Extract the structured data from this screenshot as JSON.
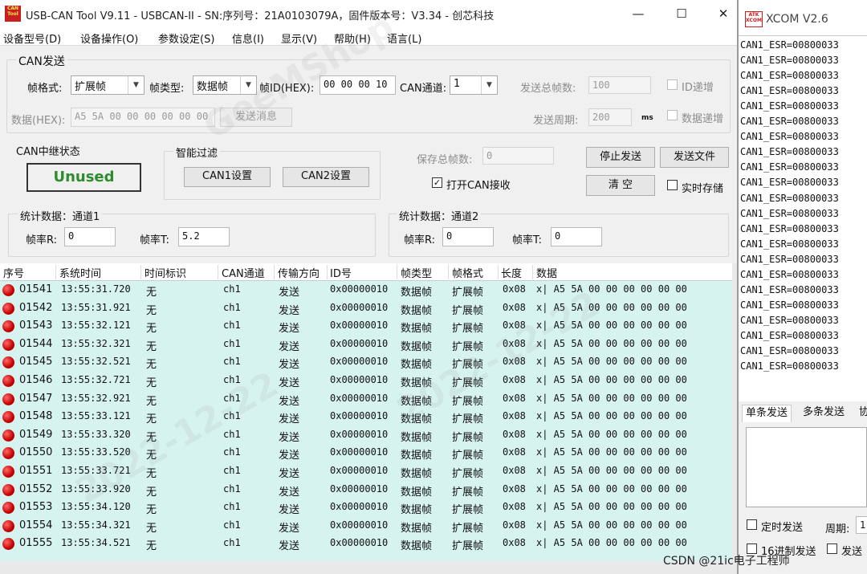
{
  "window": {
    "title": "USB-CAN Tool V9.11 - USBCAN-II - SN:序列号：21A0103079A，固件版本号：V3.34 - 创芯科技",
    "minimize": "—",
    "maximize": "☐",
    "logo_text": "CAN Tool"
  },
  "menu": [
    "设备型号(D)",
    "设备操作(O)",
    "参数设定(S)",
    "信息(I)",
    "显示(V)",
    "帮助(H)",
    "语言(L)"
  ],
  "can_send": {
    "group_title": "CAN发送",
    "frame_format_label": "帧格式:",
    "frame_format_value": "扩展帧",
    "frame_type_label": "帧类型:",
    "frame_type_value": "数据帧",
    "frame_id_label": "帧ID(HEX):",
    "frame_id_value": "00 00 00 10",
    "channel_label": "CAN通道:",
    "channel_value": "1",
    "data_label": "数据(HEX):",
    "data_value": "A5 5A 00 00 00 00 00 00",
    "send_button": "发送消息",
    "total_frames_label": "发送总帧数:",
    "total_frames_value": "100",
    "id_inc_label": "ID递增",
    "period_label": "发送周期:",
    "period_value": "200",
    "period_unit": "ms",
    "data_inc_label": "数据递增"
  },
  "relay": {
    "title": "CAN中继状态",
    "status": "Unused",
    "status_color": "#2e8b2e"
  },
  "filter": {
    "title": "智能过滤",
    "can1_button": "CAN1设置",
    "can2_button": "CAN2设置"
  },
  "controls": {
    "save_total_label": "保存总帧数:",
    "save_total_value": "0",
    "open_can_rx_label": "打开CAN接收",
    "stop_send_button": "停止发送",
    "send_file_button": "发送文件",
    "clear_button": "清 空",
    "realtime_save_label": "实时存储"
  },
  "stats1": {
    "title": "统计数据：通道1",
    "rate_r_label": "帧率R:",
    "rate_r_value": "0",
    "rate_t_label": "帧率T:",
    "rate_t_value": "5.2"
  },
  "stats2": {
    "title": "统计数据：通道2",
    "rate_r_label": "帧率R:",
    "rate_r_value": "0",
    "rate_t_label": "帧率T:",
    "rate_t_value": "0"
  },
  "table": {
    "headers": [
      "序号",
      "系统时间",
      "时间标识",
      "CAN通道",
      "传输方向",
      "ID号",
      "帧类型",
      "帧格式",
      "长度",
      "数据"
    ],
    "row_color": "#d7f3f0",
    "rows": [
      [
        "01541",
        "13:55:31.720",
        "无",
        "ch1",
        "发送",
        "0x00000010",
        "数据帧",
        "扩展帧",
        "0x08",
        "x| A5 5A 00 00 00 00 00 00"
      ],
      [
        "01542",
        "13:55:31.921",
        "无",
        "ch1",
        "发送",
        "0x00000010",
        "数据帧",
        "扩展帧",
        "0x08",
        "x| A5 5A 00 00 00 00 00 00"
      ],
      [
        "01543",
        "13:55:32.121",
        "无",
        "ch1",
        "发送",
        "0x00000010",
        "数据帧",
        "扩展帧",
        "0x08",
        "x| A5 5A 00 00 00 00 00 00"
      ],
      [
        "01544",
        "13:55:32.321",
        "无",
        "ch1",
        "发送",
        "0x00000010",
        "数据帧",
        "扩展帧",
        "0x08",
        "x| A5 5A 00 00 00 00 00 00"
      ],
      [
        "01545",
        "13:55:32.521",
        "无",
        "ch1",
        "发送",
        "0x00000010",
        "数据帧",
        "扩展帧",
        "0x08",
        "x| A5 5A 00 00 00 00 00 00"
      ],
      [
        "01546",
        "13:55:32.721",
        "无",
        "ch1",
        "发送",
        "0x00000010",
        "数据帧",
        "扩展帧",
        "0x08",
        "x| A5 5A 00 00 00 00 00 00"
      ],
      [
        "01547",
        "13:55:32.921",
        "无",
        "ch1",
        "发送",
        "0x00000010",
        "数据帧",
        "扩展帧",
        "0x08",
        "x| A5 5A 00 00 00 00 00 00"
      ],
      [
        "01548",
        "13:55:33.121",
        "无",
        "ch1",
        "发送",
        "0x00000010",
        "数据帧",
        "扩展帧",
        "0x08",
        "x| A5 5A 00 00 00 00 00 00"
      ],
      [
        "01549",
        "13:55:33.320",
        "无",
        "ch1",
        "发送",
        "0x00000010",
        "数据帧",
        "扩展帧",
        "0x08",
        "x| A5 5A 00 00 00 00 00 00"
      ],
      [
        "01550",
        "13:55:33.520",
        "无",
        "ch1",
        "发送",
        "0x00000010",
        "数据帧",
        "扩展帧",
        "0x08",
        "x| A5 5A 00 00 00 00 00 00"
      ],
      [
        "01551",
        "13:55:33.721",
        "无",
        "ch1",
        "发送",
        "0x00000010",
        "数据帧",
        "扩展帧",
        "0x08",
        "x| A5 5A 00 00 00 00 00 00"
      ],
      [
        "01552",
        "13:55:33.920",
        "无",
        "ch1",
        "发送",
        "0x00000010",
        "数据帧",
        "扩展帧",
        "0x08",
        "x| A5 5A 00 00 00 00 00 00"
      ],
      [
        "01553",
        "13:55:34.120",
        "无",
        "ch1",
        "发送",
        "0x00000010",
        "数据帧",
        "扩展帧",
        "0x08",
        "x| A5 5A 00 00 00 00 00 00"
      ],
      [
        "01554",
        "13:55:34.321",
        "无",
        "ch1",
        "发送",
        "0x00000010",
        "数据帧",
        "扩展帧",
        "0x08",
        "x| A5 5A 00 00 00 00 00 00"
      ],
      [
        "01555",
        "13:55:34.521",
        "无",
        "ch1",
        "发送",
        "0x00000010",
        "数据帧",
        "扩展帧",
        "0x08",
        "x| A5 5A 00 00 00 00 00 00"
      ]
    ]
  },
  "xcom": {
    "title": "XCOM V2.6",
    "logo_text": "ATK XCOM",
    "log_lines": [
      "CAN1_ESR=00800033",
      "CAN1_ESR=00800033",
      "CAN1_ESR=00800033",
      "CAN1_ESR=00800033",
      "CAN1_ESR=00800033",
      "CAN1_ESR=00800033",
      "CAN1_ESR=00800033",
      "CAN1_ESR=00800033",
      "CAN1_ESR=00800033",
      "CAN1_ESR=00800033",
      "CAN1_ESR=00800033",
      "CAN1_ESR=00800033",
      "CAN1_ESR=00800033",
      "CAN1_ESR=00800033",
      "CAN1_ESR=00800033",
      "CAN1_ESR=00800033",
      "CAN1_ESR=00800033",
      "CAN1_ESR=00800033",
      "CAN1_ESR=00800033",
      "CAN1_ESR=00800033",
      "CAN1_ESR=00800033",
      "CAN1_ESR=00800033"
    ],
    "tab_single": "单条发送",
    "tab_multi": "多条发送",
    "tab_partial": "协",
    "timed_send_label": "定时发送",
    "period_label": "周期:",
    "period_partial": "1(",
    "hex_send_label": "16进制发送",
    "send_partial": "发送",
    "watermark": "CSDN @21ic电子工程师"
  }
}
